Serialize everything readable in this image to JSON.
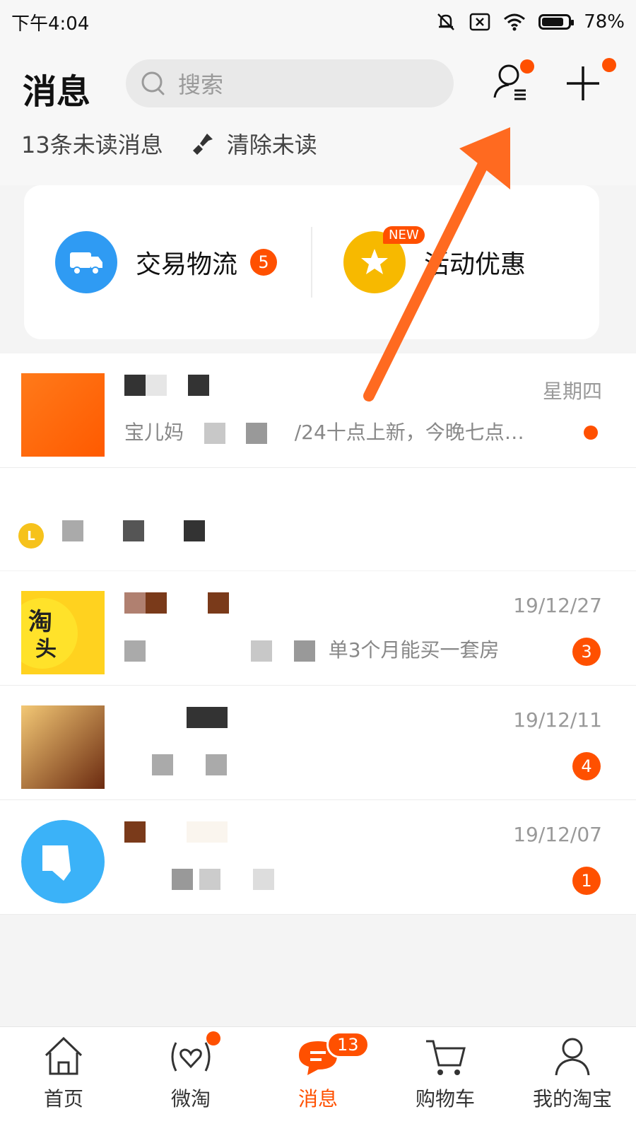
{
  "status_bar": {
    "time": "下午4:04",
    "battery": "78%"
  },
  "header": {
    "title": "消息",
    "search_placeholder": "搜索",
    "unread_summary": "13条未读消息",
    "clear_label": "清除未读"
  },
  "shortcuts": [
    {
      "label": "交易物流",
      "badge": "5",
      "color": "#2f9bf3"
    },
    {
      "label": "活动优惠",
      "tag": "NEW",
      "color": "#f7b900"
    }
  ],
  "conversations": [
    {
      "time": "星期四",
      "preview": "/24十点上新，今晚七点…",
      "preview_prefix": "宝儿妈"
    },
    {
      "time": "19/12/27",
      "preview": "单3个月能买一套房",
      "badge": "3"
    },
    {
      "time": "19/12/11",
      "badge": "4"
    },
    {
      "time": "19/12/07",
      "badge": "1"
    }
  ],
  "group_header_icon": "clock-icon",
  "tabbar": {
    "items": [
      {
        "label": "首页"
      },
      {
        "label": "微淘"
      },
      {
        "label": "消息",
        "count": "13"
      },
      {
        "label": "购物车"
      },
      {
        "label": "我的淘宝"
      }
    ]
  },
  "colors": {
    "accent": "#ff5000",
    "logistics_blue": "#2f9bf3",
    "promo_yellow": "#f7b900"
  }
}
